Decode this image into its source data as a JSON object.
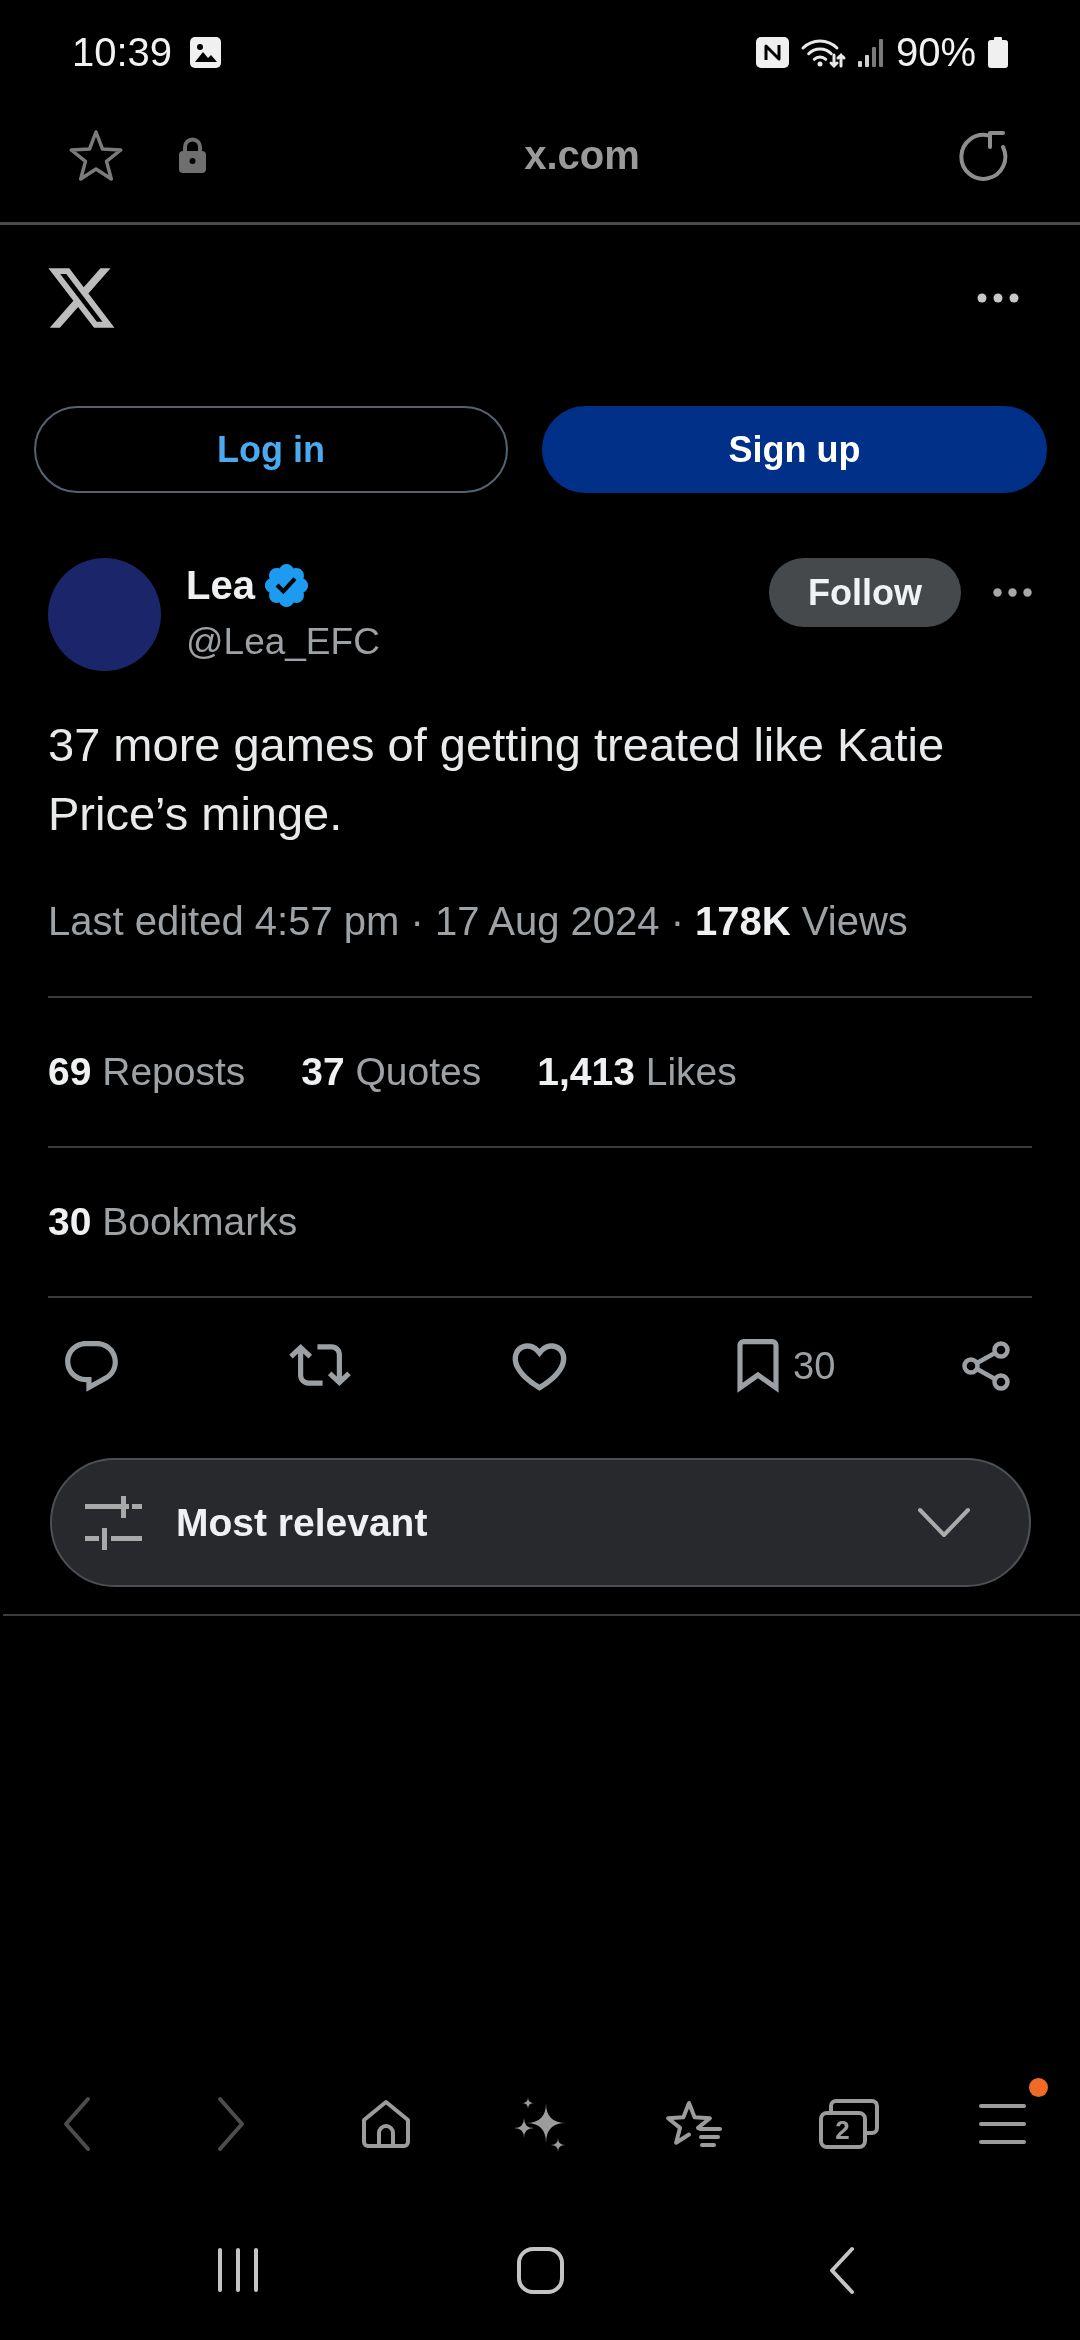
{
  "status_bar": {
    "time": "10:39",
    "battery": "90%"
  },
  "browser_bar": {
    "url": "x.com"
  },
  "auth_buttons": [
    {
      "label": "Log in",
      "kind": "outline"
    },
    {
      "label": "Sign up",
      "kind": "filled"
    }
  ],
  "post": {
    "author": {
      "name": "Lea",
      "handle": "@Lea_EFC",
      "verified": true
    },
    "follow_label": "Follow",
    "text": "37 more games of getting treated like Katie Price’s minge.",
    "meta": "Last edited 4:57 pm · 17 Aug 2024 · **178K** Views",
    "stat_rows": [
      [
        "**69** Reposts",
        "**37** Quotes",
        "**1,413** Likes"
      ],
      [
        "**30** Bookmarks"
      ]
    ],
    "actions": [
      {
        "kind": "reply"
      },
      {
        "kind": "repost"
      },
      {
        "kind": "like"
      },
      {
        "kind": "bookmark",
        "count": "30"
      },
      {
        "kind": "share"
      }
    ]
  },
  "sort": {
    "label": "Most relevant"
  },
  "browser_nav": [
    {
      "kind": "back",
      "disabled": true,
      "notification": false
    },
    {
      "kind": "forward",
      "disabled": true,
      "notification": false
    },
    {
      "kind": "home",
      "disabled": false,
      "notification": false
    },
    {
      "kind": "assistant",
      "disabled": false,
      "notification": false
    },
    {
      "kind": "bookmarks",
      "disabled": false,
      "notification": false
    },
    {
      "kind": "tabs",
      "count": "2",
      "disabled": false,
      "notification": false
    },
    {
      "kind": "menu",
      "disabled": false,
      "notification": true
    }
  ]
}
